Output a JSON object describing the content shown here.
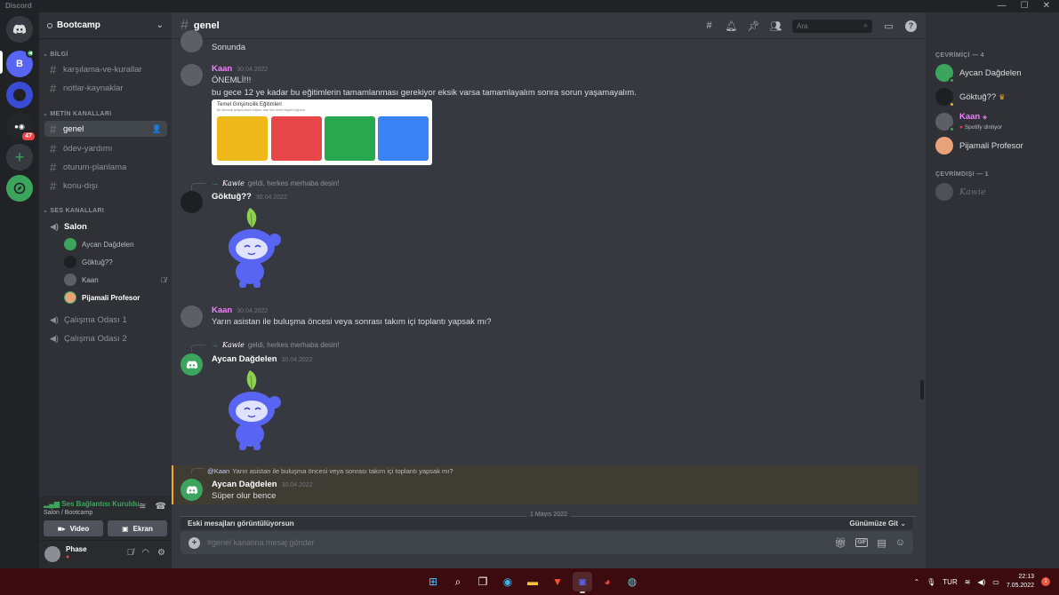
{
  "window": {
    "title": "Discord",
    "minimize": "—",
    "maximize": "☐",
    "close": "✕"
  },
  "rail": {
    "servers": [
      {
        "label": "B",
        "color": "#5865f2",
        "badge": ""
      },
      {
        "label": "",
        "color": "#3a4bd6",
        "badge": ""
      },
      {
        "label": "",
        "color": "#2f3136",
        "badge": "47"
      }
    ]
  },
  "guild": {
    "name": "Bootcamp"
  },
  "categories": {
    "info": "BİLGİ",
    "text": "METİN KANALLARI",
    "voice": "SES KANALLARI"
  },
  "channels": {
    "info": [
      "karşılama-ve-kurallar",
      "notlar-kaynaklar"
    ],
    "text": [
      "genel",
      "ödev-yardımı",
      "oturum-planlama",
      "konu-dışı"
    ],
    "voice": [
      "Salon",
      "Çalışma Odası 1",
      "Çalışma Odası 2"
    ]
  },
  "voice_users": [
    "Aycan Dağdelen",
    "Göktuğ??",
    "Kaan",
    "Pijamali Profesor"
  ],
  "voice_panel": {
    "status": "Ses Bağlantısı Kuruldu",
    "location": "Salon / Bootcamp",
    "video": "Video",
    "screen": "Ekran"
  },
  "user": {
    "name": "Phase"
  },
  "chat": {
    "channel": "genel",
    "search_placeholder": "Ara",
    "messages": {
      "m0_text": "Sonunda",
      "m1_author": "Kaan",
      "m1_time": "30.04.2022",
      "m1_line1": "ÖNEMLİ!!!",
      "m1_line2": "bu gece 12 ye kadar bu eğitimlerin tamamlanması gerekiyor eksik varsa tamamlayalım sonra sorun yaşamayalım.",
      "sys1_who": "Kawie",
      "sys1_text": "geldi, herkes merhaba desin!",
      "m2_author": "Göktuğ??",
      "m2_time": "30.04.2022",
      "m3_author": "Kaan",
      "m3_time": "30.04.2022",
      "m3_text": "Yarın asistan ile buluşma öncesi veya sonrası takım içi toplantı yapsak mı?",
      "sys2_who": "Kawie",
      "sys2_text": "geldi, herkes merhaba desin!",
      "m4_author": "Aycan Dağdelen",
      "m4_time": "30.04.2022",
      "reply_mention": "@Kaan",
      "reply_text": "Yarın asistan ile buluşma öncesi veya sonrası takım içi toplantı yapsak mı?",
      "m5_author": "Aycan Dağdelen",
      "m5_time": "30.04.2022",
      "m5_text": "Süper olur bence"
    },
    "embed": {
      "title": "Temel Girişimcilik Eğitimleri",
      "subtitle": "Bir teknoloji girişimcisinin ihtiyacı olan tüm temel bilgileri öğrenin."
    },
    "divider": "1 Mayıs 2022",
    "old_messages": "Eski mesajları görüntülüyorsun",
    "jump": "Günümüze Git",
    "input_placeholder": "#genel kanalına mesaj gönder"
  },
  "members": {
    "online_header": "ÇEVRİMİÇİ — 4",
    "offline_header": "ÇEVRİMDIŞI — 1",
    "online": [
      {
        "name": "Aycan Dağdelen",
        "color": "#dcddde",
        "sub": ""
      },
      {
        "name": "Göktuğ??",
        "color": "#dcddde",
        "sub": ""
      },
      {
        "name": "Kaan",
        "color": "#f47fff",
        "sub": "Spotify dinliyor"
      },
      {
        "name": "Pijamali Profesor",
        "color": "#dcddde",
        "sub": ""
      }
    ],
    "offline": [
      {
        "name": "Kawie"
      }
    ]
  },
  "taskbar": {
    "lang": "TUR",
    "time": "22:13",
    "date": "7.05.2022",
    "notif": "1"
  },
  "colors": {
    "accent": "#5865f2",
    "kaan": "#f47fff",
    "online": "#3ba55d",
    "idle": "#faa81a",
    "dnd": "#ed4245"
  }
}
